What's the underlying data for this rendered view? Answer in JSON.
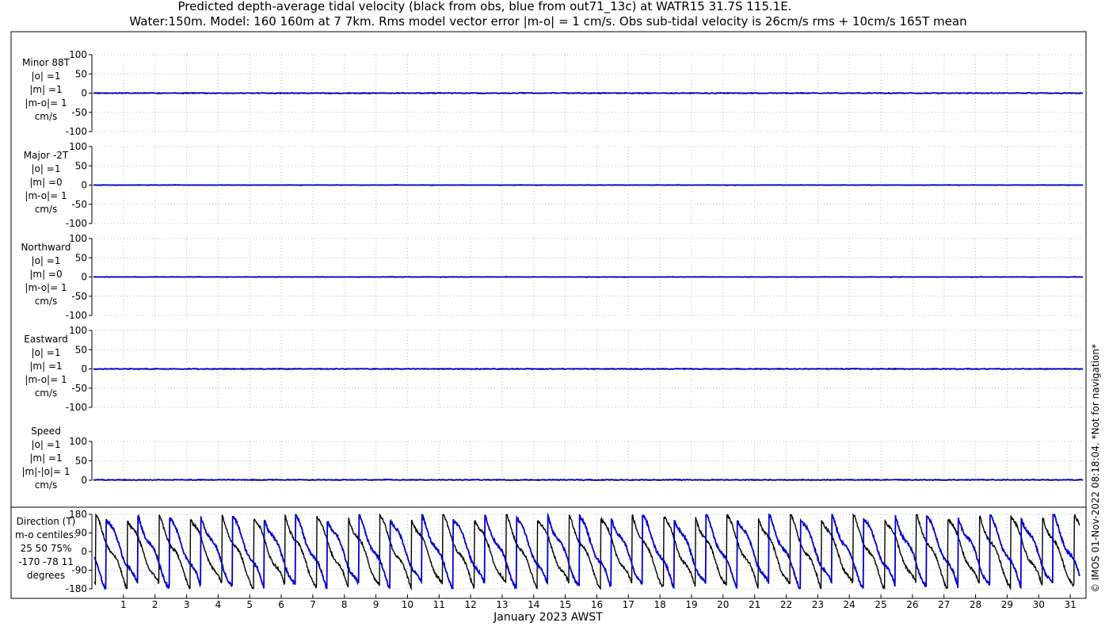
{
  "title": {
    "line1": "Predicted depth-average tidal velocity (black from obs, blue from out71_13c) at WATR15 31.7S 115.1E.",
    "line2": "Water:150m. Model: 160 160m at 7 7km. Rms model vector error |m-o| = 1 cm/s. Obs sub-tidal velocity is 26cm/s rms + 10cm/s 165T mean"
  },
  "footer_note": "© IMOS 01-Nov-2022 08:18:04. *Not for navigation*",
  "xlabel": "January 2023 AWST",
  "colors": {
    "obs": "#000000",
    "model": "#0000cc",
    "grid": "#bbbbbb"
  },
  "chart_data": [
    {
      "type": "line",
      "panel": "minor",
      "label_lines": [
        "Minor 88T",
        "|o| =1",
        "|m| =1",
        "|m-o|= 1",
        "cm/s"
      ],
      "ylim": [
        -100,
        100
      ],
      "yticks": [
        100,
        50,
        0,
        -50,
        -100
      ],
      "xlim": [
        0,
        31.5
      ],
      "xticks": [
        1,
        2,
        3,
        4,
        5,
        6,
        7,
        8,
        9,
        10,
        11,
        12,
        13,
        14,
        15,
        16,
        17,
        18,
        19,
        20,
        21,
        22,
        23,
        24,
        25,
        26,
        27,
        28,
        29,
        30,
        31
      ],
      "grid": true,
      "series": [
        {
          "color_key": "obs",
          "approx_value": 0,
          "amplitude": 1
        },
        {
          "color_key": "model",
          "approx_value": 0,
          "amplitude": 1
        }
      ]
    },
    {
      "type": "line",
      "panel": "major",
      "label_lines": [
        "Major -2T",
        "|o| =1",
        "|m| =0",
        "|m-o|= 1",
        "cm/s"
      ],
      "ylim": [
        -100,
        100
      ],
      "yticks": [
        100,
        50,
        0,
        -50,
        -100
      ],
      "xlim": [
        0,
        31.5
      ],
      "xticks": [
        1,
        2,
        3,
        4,
        5,
        6,
        7,
        8,
        9,
        10,
        11,
        12,
        13,
        14,
        15,
        16,
        17,
        18,
        19,
        20,
        21,
        22,
        23,
        24,
        25,
        26,
        27,
        28,
        29,
        30,
        31
      ],
      "grid": true,
      "series": [
        {
          "color_key": "obs",
          "approx_value": 0,
          "amplitude": 1
        },
        {
          "color_key": "model",
          "approx_value": 0,
          "amplitude": 0
        }
      ]
    },
    {
      "type": "line",
      "panel": "northward",
      "label_lines": [
        "Northward",
        "|o| =1",
        "|m| =0",
        "|m-o|= 1",
        "cm/s"
      ],
      "ylim": [
        -100,
        100
      ],
      "yticks": [
        100,
        50,
        0,
        -50,
        -100
      ],
      "xlim": [
        0,
        31.5
      ],
      "xticks": [
        1,
        2,
        3,
        4,
        5,
        6,
        7,
        8,
        9,
        10,
        11,
        12,
        13,
        14,
        15,
        16,
        17,
        18,
        19,
        20,
        21,
        22,
        23,
        24,
        25,
        26,
        27,
        28,
        29,
        30,
        31
      ],
      "grid": true,
      "series": [
        {
          "color_key": "obs",
          "approx_value": 0,
          "amplitude": 1
        },
        {
          "color_key": "model",
          "approx_value": 0,
          "amplitude": 0
        }
      ]
    },
    {
      "type": "line",
      "panel": "eastward",
      "label_lines": [
        "Eastward",
        "|o| =1",
        "|m| =1",
        "|m-o|= 1",
        "cm/s"
      ],
      "ylim": [
        -100,
        100
      ],
      "yticks": [
        100,
        50,
        0,
        -50,
        -100
      ],
      "xlim": [
        0,
        31.5
      ],
      "xticks": [
        1,
        2,
        3,
        4,
        5,
        6,
        7,
        8,
        9,
        10,
        11,
        12,
        13,
        14,
        15,
        16,
        17,
        18,
        19,
        20,
        21,
        22,
        23,
        24,
        25,
        26,
        27,
        28,
        29,
        30,
        31
      ],
      "grid": true,
      "series": [
        {
          "color_key": "obs",
          "approx_value": 0,
          "amplitude": 1
        },
        {
          "color_key": "model",
          "approx_value": 0,
          "amplitude": 1
        }
      ]
    },
    {
      "type": "line",
      "panel": "speed",
      "label_lines": [
        "Speed",
        "|o| =1",
        "|m| =1",
        "|m|-|o|= 1",
        "cm/s"
      ],
      "ylim": [
        0,
        100
      ],
      "yticks": [
        100,
        50,
        0
      ],
      "xlim": [
        0,
        31.5
      ],
      "xticks": [
        1,
        2,
        3,
        4,
        5,
        6,
        7,
        8,
        9,
        10,
        11,
        12,
        13,
        14,
        15,
        16,
        17,
        18,
        19,
        20,
        21,
        22,
        23,
        24,
        25,
        26,
        27,
        28,
        29,
        30,
        31
      ],
      "grid": true,
      "series": [
        {
          "color_key": "obs",
          "approx_value": 1,
          "amplitude": 1
        },
        {
          "color_key": "model",
          "approx_value": 1,
          "amplitude": 1
        }
      ]
    },
    {
      "type": "line",
      "panel": "direction",
      "label_lines": [
        "Direction (T)",
        "m-o centiles:",
        "25  50  75%",
        "-170  -78   11",
        "degrees"
      ],
      "ylim": [
        -180,
        180
      ],
      "yticks": [
        180,
        90,
        0,
        -90,
        -180
      ],
      "xlim": [
        0,
        31.5
      ],
      "xticks": [
        1,
        2,
        3,
        4,
        5,
        6,
        7,
        8,
        9,
        10,
        11,
        12,
        13,
        14,
        15,
        16,
        17,
        18,
        19,
        20,
        21,
        22,
        23,
        24,
        25,
        26,
        27,
        28,
        29,
        30,
        31
      ],
      "grid": true,
      "period_days": 1.0,
      "series": [
        {
          "color_key": "obs",
          "phase_days": 0.12
        },
        {
          "color_key": "model",
          "phase_days": 0.45
        }
      ]
    }
  ]
}
